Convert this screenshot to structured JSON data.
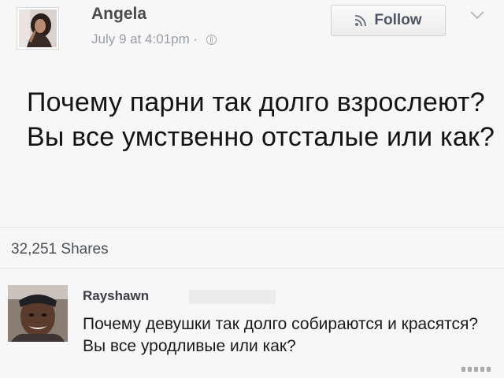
{
  "post": {
    "author": "Angela",
    "timestamp": "July 9 at 4:01pm",
    "separator": "·",
    "privacy_icon": "globe-icon",
    "follow_label": "Follow",
    "follow_icon": "rss-icon",
    "menu_icon": "chevron-down-icon",
    "text": "Почему парни так долго взрослеют? Вы все умственно отсталые или как?",
    "shares_count": "32,251",
    "shares_label": "Shares"
  },
  "comment": {
    "author": "Rayshawn",
    "text": "Почему девушки так долго собираются и красятся? Вы все уродливые или как?"
  },
  "colors": {
    "background": "#f7f7f7",
    "author_text": "#4a4a4a",
    "meta_text": "#9a9ea5",
    "button_text": "#4e5665"
  }
}
